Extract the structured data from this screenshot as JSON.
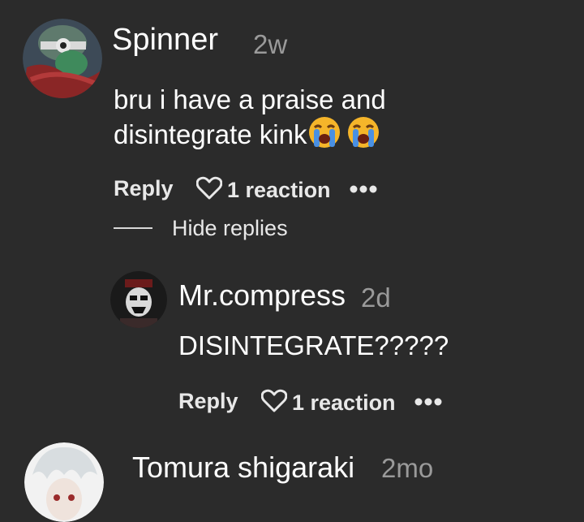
{
  "comments": [
    {
      "username": "Spinner",
      "timestamp": "2w",
      "text_line1": "bru i have a praise and",
      "text_line2": "disintegrate kink",
      "emoji": "loudly-crying-face-emoji",
      "reply_label": "Reply",
      "reaction_label": "1 reaction",
      "more_icon": "more-dots-icon"
    }
  ],
  "replies_toggle": {
    "label": "Hide replies"
  },
  "replies": [
    {
      "username": "Mr.compress",
      "timestamp": "2d",
      "text": "DISINTEGRATE?????",
      "reply_label": "Reply",
      "reaction_label": "1 reaction",
      "more_icon": "more-dots-icon"
    }
  ],
  "next_comment": {
    "username": "Tomura shigaraki",
    "timestamp": "2mo"
  },
  "colors": {
    "background": "#2b2b2b",
    "text": "#ffffff",
    "muted": "#9a9a9a"
  }
}
